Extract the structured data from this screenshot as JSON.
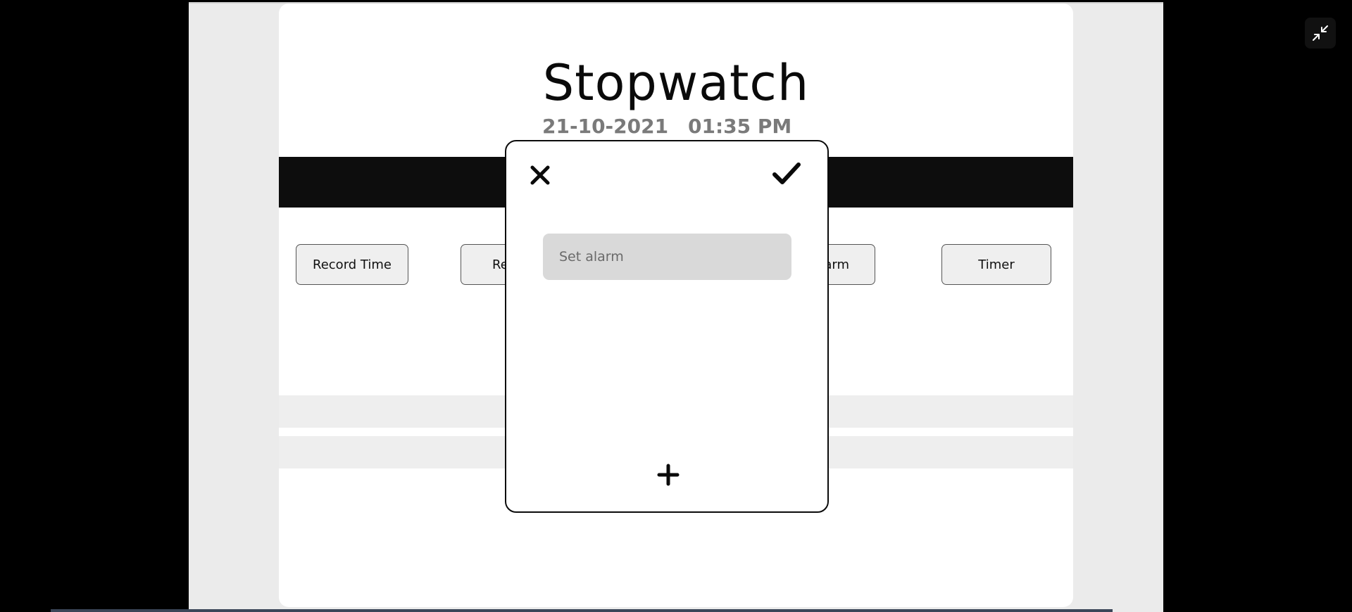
{
  "app": {
    "title": "Stopwatch",
    "date": "21-10-2021",
    "time": "01:35 PM"
  },
  "nav": {
    "record_time_label": "Record Time",
    "reset_label_visible": "Re",
    "alarm_label_visible": "arm",
    "timer_label": "Timer"
  },
  "modal": {
    "alarm_placeholder": "Set alarm",
    "alarm_value": ""
  },
  "icons": {
    "close": "close-icon",
    "confirm": "check-icon",
    "add": "plus-icon",
    "collapse": "collapse-icon"
  },
  "colors": {
    "background": "#000000",
    "stage": "#ebebeb",
    "card": "#ffffff",
    "band": "#0d0d0d",
    "input_fill": "#d9d9d9",
    "muted_text": "#7a7a7a"
  }
}
